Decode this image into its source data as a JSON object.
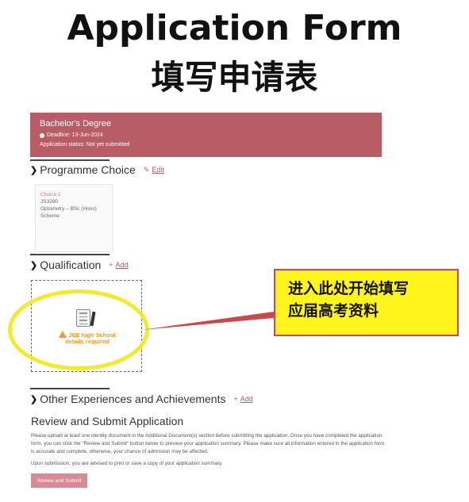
{
  "overlay": {
    "heading_en": "Application Form",
    "heading_zh": "填写申请表",
    "callout_line1": "进入此处开始填写",
    "callout_line2": "应届高考资料",
    "highlight_color": "#f2ea2a",
    "callout_color": "#fff51a"
  },
  "banner": {
    "title": "Bachelor's Degree",
    "deadline": "Deadline: 13-Jun-2024",
    "status": "Application status: Not yet submitted",
    "color": "#b85c66"
  },
  "programme": {
    "title": "Programme Choice",
    "edit_label": "Edit",
    "card": {
      "label": "Choice 1",
      "code": "JS3290",
      "name": "Optometry – BSc (Hons)",
      "scheme": "Scheme"
    }
  },
  "qualification": {
    "title": "Qualification",
    "add_label": "Add",
    "warning_line1": "JEE high School",
    "warning_line2": "details required"
  },
  "experiences": {
    "title": "Other Experiences and Achievements",
    "add_label": "Add"
  },
  "review": {
    "title": "Review and Submit Application",
    "paragraph1": "Please upload at least one identity document in the Additional Document(s) section before submitting the application. Once you have completed the application form, you can click the \"Review and Submit\" button below to preview your application summary. Please make sure all information entered in the application form is accurate and complete, otherwise, your chance of admission may be affected.",
    "paragraph2": "Upon submission, you are advised to print or save a copy of your application summary.",
    "button_label": "Review and Submit"
  }
}
